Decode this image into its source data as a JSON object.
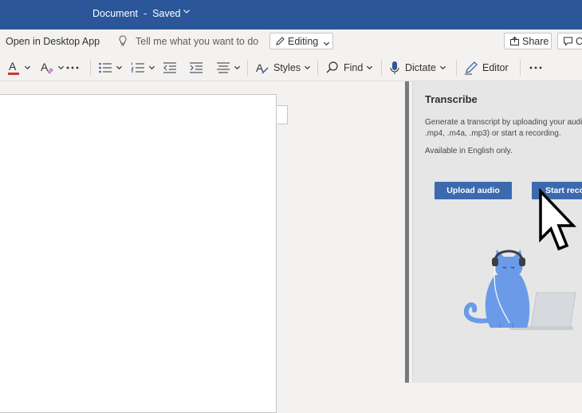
{
  "titlebar": {
    "doc_name": "Document",
    "sep": "-",
    "status": "Saved"
  },
  "ribbon_top": {
    "open_desktop": "Open in Desktop App",
    "tell_me": "Tell me what you want to do",
    "editing": "Editing",
    "share": "Share",
    "comments": "C"
  },
  "toolbar": {
    "styles": "Styles",
    "find": "Find",
    "dictate": "Dictate",
    "editor": "Editor",
    "font_color": "A",
    "more": "···"
  },
  "transcribe_pane": {
    "title": "Transcribe",
    "description": "Generate a transcript by uploading your audi\n.mp4, .m4a, .mp3) or start a recording.",
    "note": "Available in English only.",
    "upload_button": "Upload audio",
    "record_button": "Start recording"
  },
  "colors": {
    "titlebar": "#2b579a",
    "primary_button": "#3d6aae",
    "font_color_underline": "#d13438",
    "cat": "#6b9be8"
  },
  "icons": [
    "chevron-down-icon",
    "lightbulb-icon",
    "pencil-icon",
    "share-icon",
    "comment-icon",
    "font-color-icon",
    "text-effects-icon",
    "more-icon",
    "bullets-icon",
    "numbering-icon",
    "decrease-indent-icon",
    "increase-indent-icon",
    "align-icon",
    "styles-icon",
    "search-icon",
    "microphone-icon",
    "editor-icon",
    "cursor-icon"
  ]
}
